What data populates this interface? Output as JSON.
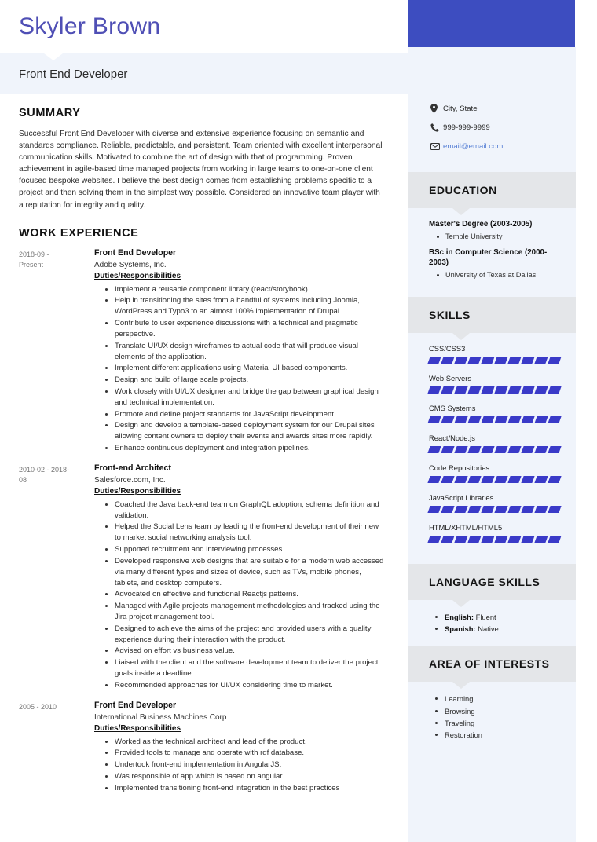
{
  "theme": {
    "accent_blue": "#3d4dc0",
    "name_purple": "#4f4fb5",
    "sidebar_bg": "#f0f4fb",
    "section_head_bg": "#e4e6e9",
    "skill_bar": "#3a3ac8",
    "email_link": "#5a82d6"
  },
  "header": {
    "name": "Skyler Brown",
    "job_title": "Front End Developer"
  },
  "summary": {
    "heading": "SUMMARY",
    "text": "Successful Front End Developer with diverse and extensive experience focusing on semantic and standards compliance. Reliable, predictable, and persistent. Team oriented with excellent interpersonal communication skills. Motivated to combine the art of design with that of programming. Proven achievement in agile-based time managed projects from working in large teams to one-on-one client focused bespoke websites. I believe the best design comes from establishing problems specific to a project and then solving them in the simplest way possible. Considered an innovative team player with a reputation for integrity and quality."
  },
  "work": {
    "heading": "WORK EXPERIENCE",
    "duties_label": "Duties/Responsibilities",
    "jobs": [
      {
        "dates": "2018-09 - Present",
        "role": "Front End Developer",
        "company": "Adobe Systems, Inc.",
        "duties": [
          "Implement a reusable component library (react/storybook).",
          "Help in transitioning the sites from a handful of systems including Joomla, WordPress and Typo3 to an almost 100% implementation of Drupal.",
          "Contribute to user experience discussions with a technical and pragmatic perspective.",
          "Translate UI/UX design wireframes to actual code that will produce visual elements of the application.",
          "Implement different applications using Material UI based components.",
          "Design and build of large scale projects.",
          "Work closely with UI/UX designer and bridge the gap between graphical design and technical implementation.",
          "Promote and define project standards for JavaScript development.",
          "Design and develop a template-based deployment system for our Drupal sites allowing content owners to deploy their events and awards sites more rapidly.",
          "Enhance continuous deployment and integration pipelines."
        ]
      },
      {
        "dates": "2010-02 - 2018-08",
        "role": "Front-end Architect",
        "company": "Salesforce.com, Inc.",
        "duties": [
          "Coached the Java back-end team on GraphQL adoption, schema definition and validation.",
          "Helped the Social Lens team by leading the front-end development of their new to market social networking analysis tool.",
          "Supported recruitment and interviewing processes.",
          "Developed responsive web designs that are suitable for a modern web accessed via many different types and sizes of device, such as TVs, mobile phones, tablets, and desktop computers.",
          "Advocated on effective and functional Reactjs patterns.",
          "Managed with Agile projects management methodologies and tracked using the Jira project management tool.",
          "Designed to achieve the aims of the project and provided users with a quality experience during their interaction with the product.",
          "Advised on effort vs business value.",
          "Liaised with the client and the software development team to deliver the project goals inside a deadline.",
          "Recommended approaches for UI/UX considering time to market."
        ]
      },
      {
        "dates": "2005 - 2010",
        "role": "Front End Developer",
        "company": "International Business Machines Corp",
        "duties": [
          "Worked as the technical architect and lead of the product.",
          "Provided tools to manage and operate with rdf database.",
          "Undertook front-end implementation in AngularJS.",
          "Was responsible of app which is based on angular.",
          "Implemented transitioning front-end integration in the best practices"
        ]
      }
    ]
  },
  "contact": {
    "location": "City, State",
    "phone": "999-999-9999",
    "email": "email@email.com",
    "icons": {
      "location": "map-pin-icon",
      "phone": "phone-icon",
      "email": "envelope-icon"
    }
  },
  "education": {
    "heading": "EDUCATION",
    "items": [
      {
        "degree": "Master's Degree (2003-2005)",
        "school": "Temple University"
      },
      {
        "degree": "BSc in Computer Science (2000-2003)",
        "school": "University of Texas at Dallas"
      }
    ]
  },
  "skills": {
    "heading": "SKILLS",
    "segments_total": 10,
    "items": [
      {
        "name": "CSS/CSS3",
        "filled": 10
      },
      {
        "name": "Web Servers",
        "filled": 10
      },
      {
        "name": "CMS Systems",
        "filled": 10
      },
      {
        "name": "React/Node.js",
        "filled": 10
      },
      {
        "name": "Code Repositories",
        "filled": 10
      },
      {
        "name": "JavaScript Libraries",
        "filled": 10
      },
      {
        "name": "HTML/XHTML/HTML5",
        "filled": 10
      }
    ]
  },
  "languages": {
    "heading": "LANGUAGE SKILLS",
    "items": [
      {
        "language": "English",
        "level": "Fluent"
      },
      {
        "language": "Spanish",
        "level": "Native"
      }
    ]
  },
  "interests": {
    "heading": "AREA OF INTERESTS",
    "items": [
      "Learning",
      "Browsing",
      "Traveling",
      "Restoration"
    ]
  }
}
